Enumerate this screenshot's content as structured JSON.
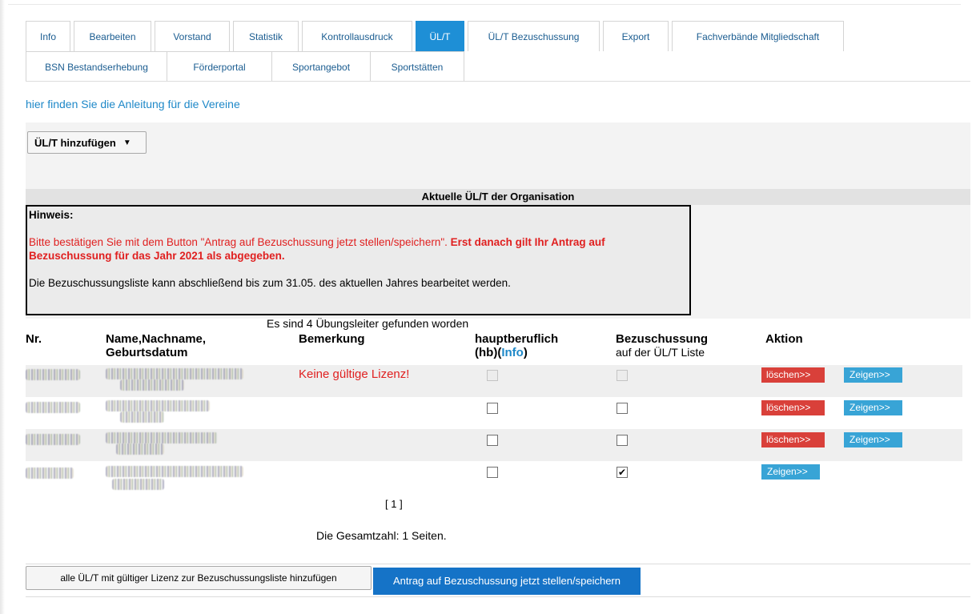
{
  "tabs": {
    "row1": [
      {
        "label": "Info",
        "active": false
      },
      {
        "label": "Bearbeiten",
        "active": false
      },
      {
        "label": "Vorstand",
        "active": false
      },
      {
        "label": "Statistik",
        "active": false
      },
      {
        "label": "Kontrollausdruck",
        "active": false
      },
      {
        "label": "ÜL/T",
        "active": true
      },
      {
        "label": "ÜL/T Bezuschussung",
        "active": false
      },
      {
        "label": "Export",
        "active": false
      },
      {
        "label": "Fachverbände Mitgliedschaft",
        "active": false
      }
    ],
    "row2": [
      {
        "label": "BSN Bestandserhebung"
      },
      {
        "label": "Förderportal"
      },
      {
        "label": "Sportangebot"
      },
      {
        "label": "Sportstätten"
      }
    ]
  },
  "guide_link": "hier finden Sie die Anleitung für die Vereine",
  "add_button": {
    "label": "ÜL/T hinzufügen",
    "caret": "▼"
  },
  "section_title": "Aktuelle ÜL/T der Organisation",
  "hint": {
    "title": "Hinweis:",
    "red_text": "Bitte bestätigen Sie mit dem Button \"Antrag auf Bezuschussung jetzt stellen/speichern\". ",
    "red_bold": "Erst danach gilt Ihr Antrag auf Bezuschussung für das Jahr 2021 als abgegeben.",
    "note": "Die Bezuschussungsliste kann abschließend bis zum 31.05. des aktuellen Jahres bearbeitet werden."
  },
  "found_text": "Es sind 4 Übungsleiter gefunden worden",
  "table": {
    "headers": {
      "nr": "Nr.",
      "name_line1": "Name,Nachname,",
      "name_line2": "Geburtsdatum",
      "remark": "Bemerkung",
      "hb_line1": "hauptberuflich",
      "hb_prefix": "(hb)(",
      "hb_info": "Info",
      "hb_suffix": ")",
      "subsidy_line1": "Bezuschussung",
      "subsidy_line2": "auf der ÜL/T Liste",
      "action": "Aktion"
    },
    "rows": [
      {
        "remark": "Keine gültige Lizenz!",
        "hb_checked": false,
        "hb_disabled": true,
        "subsidy_checked": false,
        "subsidy_disabled": true,
        "delete_label": "löschen>>",
        "show_label": "Zeigen>>"
      },
      {
        "remark": "",
        "hb_checked": false,
        "hb_disabled": false,
        "subsidy_checked": false,
        "subsidy_disabled": false,
        "delete_label": "löschen>>",
        "show_label": "Zeigen>>"
      },
      {
        "remark": "",
        "hb_checked": false,
        "hb_disabled": false,
        "subsidy_checked": false,
        "subsidy_disabled": false,
        "delete_label": "löschen>>",
        "show_label": "Zeigen>>"
      },
      {
        "remark": "",
        "hb_checked": false,
        "hb_disabled": false,
        "subsidy_checked": true,
        "subsidy_disabled": false,
        "delete_label": "",
        "show_label": "Zeigen>>"
      }
    ]
  },
  "pager": "[ 1 ]",
  "total": "Die Gesamtzahl: 1 Seiten.",
  "buttons": {
    "bulk_add": "alle ÜL/T mit gültiger Lizenz zur Bezuschussungsliste hinzufügen",
    "submit": "Antrag auf Bezuschussung jetzt stellen/speichern"
  },
  "colors": {
    "accent": "#1e8fd6",
    "danger": "#d9403a",
    "info_button": "#38a4d6",
    "submit": "#1573c7",
    "warning_text": "#e02020"
  }
}
